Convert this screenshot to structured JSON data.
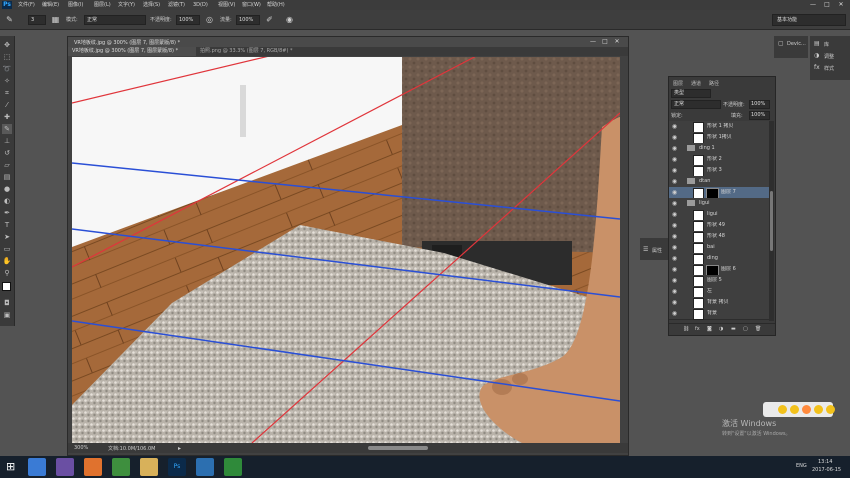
{
  "app": {
    "logo": "Ps"
  },
  "menu": [
    "文件(F)",
    "编辑(E)",
    "图像(I)",
    "图层(L)",
    "文字(Y)",
    "选择(S)",
    "滤镜(T)",
    "3D(D)",
    "视图(V)",
    "窗口(W)",
    "帮助(H)"
  ],
  "window_controls": {
    "minimize": "—",
    "maximize": "□",
    "close": "✕"
  },
  "options": {
    "brush_size": "3",
    "mode_label": "模式:",
    "mode_value": "正常",
    "opacity_label": "不透明度:",
    "opacity_value": "100%",
    "flow_label": "流量:",
    "flow_value": "100%",
    "workspace": "基本功能"
  },
  "document": {
    "title": "VR地板纹.jpg @ 300% (图层 7, 图层蒙版/8) *",
    "tabs": [
      "VR地板纹.jpg @ 300% (图层 7, 图层蒙版/8) *",
      "拍照.png @ 33.3% (图层 7, RGB/8#) *"
    ],
    "zoom": "300%",
    "doc_info": "文档:10.0M/106.0M"
  },
  "dock": {
    "item1": "Devic...",
    "lib": "库",
    "adjust": "调整",
    "styles": "样式",
    "props": "属性"
  },
  "layers_panel": {
    "tabs": [
      "图层",
      "通道",
      "路径"
    ],
    "filter": "类型",
    "blend": "正常",
    "opacity_label": "不透明度:",
    "opacity_value": "100%",
    "lock_label": "锁定:",
    "fill_label": "填充:",
    "fill_value": "100%",
    "rows": [
      {
        "name": "形状 1 拷贝",
        "type": "layer"
      },
      {
        "name": "形状 1拷贝",
        "type": "layer"
      },
      {
        "name": "ding 1",
        "type": "group"
      },
      {
        "name": "形状 2",
        "type": "layer"
      },
      {
        "name": "形状 3",
        "type": "layer"
      },
      {
        "name": "dtan",
        "type": "group"
      },
      {
        "name": "图层 7",
        "type": "masked",
        "selected": true
      },
      {
        "name": "ligui",
        "type": "group"
      },
      {
        "name": "ligui",
        "type": "layer"
      },
      {
        "name": "形状 49",
        "type": "layer"
      },
      {
        "name": "形状 48",
        "type": "layer"
      },
      {
        "name": "bai",
        "type": "layer"
      },
      {
        "name": "ding",
        "type": "layer"
      },
      {
        "name": "图层 6",
        "type": "masked"
      },
      {
        "name": "图层 5",
        "type": "layer"
      },
      {
        "name": "左",
        "type": "layer"
      },
      {
        "name": "背景 拷贝",
        "type": "layer"
      },
      {
        "name": "背景",
        "type": "layer"
      }
    ]
  },
  "watermark": {
    "line1": "激活 Windows",
    "line2": "转到\"设置\"以激活 Windows。"
  },
  "taskbar": {
    "lang": "ENG",
    "time": "13:14",
    "date": "2017-06-15"
  },
  "colors": {
    "accent_red": "#e0353b",
    "guide_blue": "#2a4fd6",
    "selected": "#536a86"
  }
}
